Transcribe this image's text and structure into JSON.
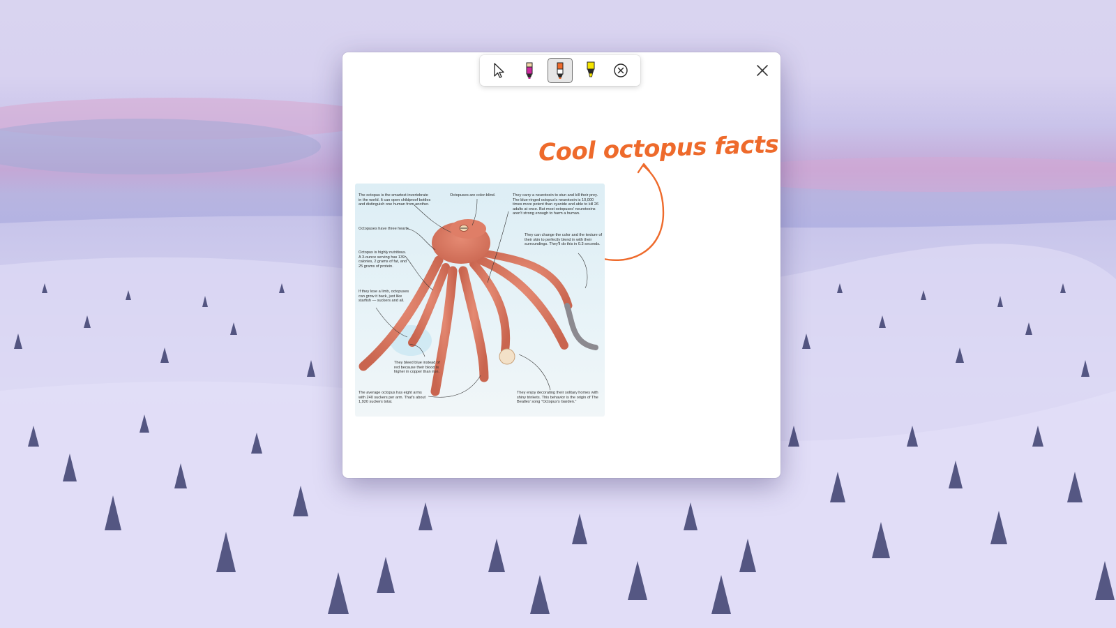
{
  "wallpaper": {
    "name": "snowy-landscape"
  },
  "toolbar": {
    "tools": [
      {
        "name": "select-tool",
        "icon": "cursor-arrow-icon"
      },
      {
        "name": "pen-tool",
        "icon": "pen-icon",
        "color": "#cc2a9e"
      },
      {
        "name": "pen-tool-orange",
        "icon": "pen-icon",
        "color": "#ee6a2b",
        "selected": true
      },
      {
        "name": "highlighter-tool",
        "icon": "highlighter-icon",
        "color": "#f5e400"
      },
      {
        "name": "eraser-tool",
        "icon": "circle-x-icon"
      }
    ]
  },
  "annotation": {
    "text": "Cool octopus facts",
    "color": "#ee6a2b"
  },
  "infographic": {
    "facts": [
      "The octopus is the smartest invertebrate in the world. It can open childproof bottles and distinguish one human from another.",
      "Octopuses are color-blind.",
      "They carry a neurotoxin to stun and kill their prey. The blue-ringed octopus's neurotoxin is 10,000 times more potent than cyanide and able to kill 26 adults at once. But most octopuses' neurotoxins aren't strong enough to harm a human.",
      "Octopuses have three hearts.",
      "They can change the color and the texture of their skin to perfectly blend in with their surroundings. They'll do this in 0.3 seconds.",
      "Octopus is highly nutritious. A 3-ounce serving has 139 calories, 2 grams of fat, and 25 grams of protein.",
      "If they lose a limb, octopuses can grow it back, just like starfish — suckers and all.",
      "They bleed blue instead of red because their blood is higher in copper than iron.",
      "The average octopus has eight arms with 240 suckers per arm. That's about 1,920 suckers total.",
      "They enjoy decorating their solitary homes with shiny trinkets. This behavior is the origin of The Beatles' song \"Octopus's Garden.\""
    ]
  }
}
